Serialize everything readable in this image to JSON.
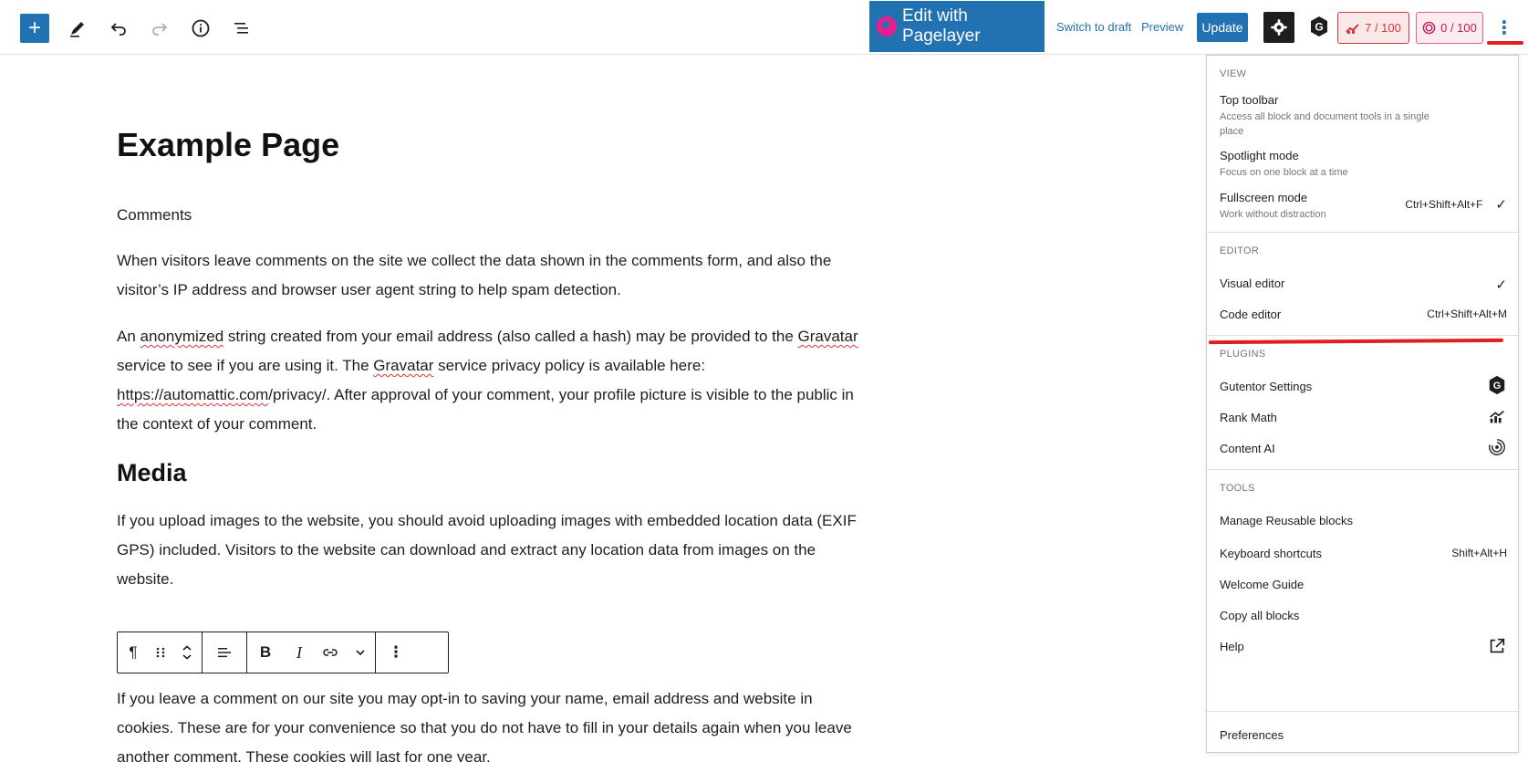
{
  "toolbar": {
    "add_icon": "plus-icon",
    "pagelayer_label": "Edit with Pagelayer",
    "switch_draft_label": "Switch to draft",
    "preview_label": "Preview",
    "update_label": "Update",
    "seo_score": "7 / 100",
    "ai_score": "0 / 100"
  },
  "document": {
    "title": "Example Page",
    "p_comments": "Comments",
    "p_visitors": "When visitors leave comments on the site we collect the data shown in the comments form, and also the visitor’s IP address and browser user agent string to help spam detection.",
    "p_gravatar_1": "An ",
    "p_gravatar_anon": "anonymized",
    "p_gravatar_2": " string created from your email address (also called a hash) may be provided to the ",
    "p_gravatar_grav": "Gravatar",
    "p_gravatar_3": " service to see if you are using it. The ",
    "p_gravatar_grav2": "Gravatar",
    "p_gravatar_4": " service privacy policy is available here: ",
    "p_gravatar_url": "https://automattic.com",
    "p_gravatar_5": "/privacy/. After approval of your comment, your profile picture is visible to the public in the context of your comment.",
    "h_media": "Media",
    "p_media": "If you upload images to the website, you should avoid uploading images with embedded location data (EXIF GPS) included. Visitors to the website can download and extract any location data from images on the website.",
    "p_cookies": "If you leave a comment on our site you may opt-in to saving your name, email address and website in cookies. These are for your convenience so that you do not have to fill in your details again when you leave another comment. These cookies will last for one year."
  },
  "menu": {
    "view": {
      "title": "View",
      "top_toolbar": {
        "label": "Top toolbar",
        "desc": "Access all block and document tools in a single place"
      },
      "spotlight": {
        "label": "Spotlight mode",
        "desc": "Focus on one block at a time"
      },
      "fullscreen": {
        "label": "Fullscreen mode",
        "desc": "Work without distraction",
        "shortcut": "Ctrl+Shift+Alt+F",
        "check": "✓"
      }
    },
    "editor": {
      "title": "Editor",
      "visual": {
        "label": "Visual editor",
        "check": "✓"
      },
      "code": {
        "label": "Code editor",
        "shortcut": "Ctrl+Shift+Alt+M"
      }
    },
    "plugins": {
      "title": "Plugins",
      "gutentor": "Gutentor Settings",
      "rankmath": "Rank Math",
      "contentai": "Content AI"
    },
    "tools": {
      "title": "Tools",
      "reusable": "Manage Reusable blocks",
      "shortcuts": {
        "label": "Keyboard shortcuts",
        "shortcut": "Shift+Alt+H"
      },
      "welcome": "Welcome Guide",
      "copy": "Copy all blocks",
      "help": "Help"
    },
    "preferences": "Preferences"
  },
  "colors": {
    "primary": "#2271b1",
    "seo_red": "#d63638",
    "annotation_red": "#e11d1d"
  }
}
